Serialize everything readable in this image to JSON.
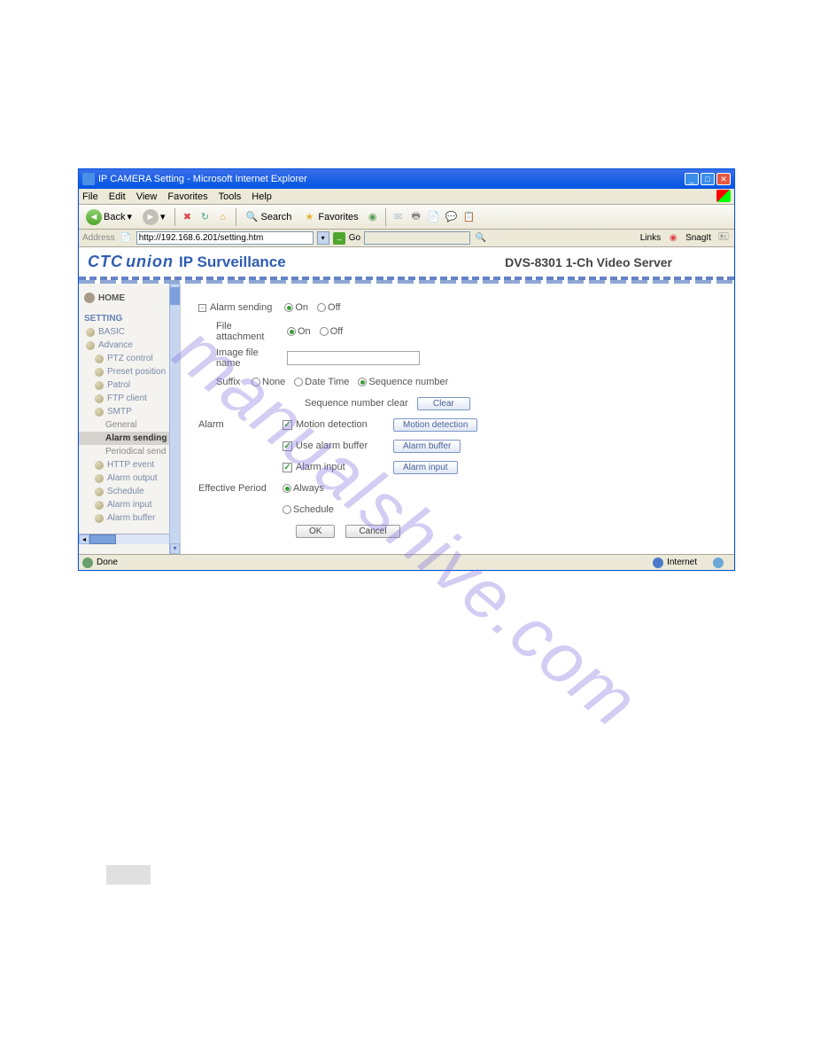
{
  "window": {
    "title": "IP CAMERA Setting - Microsoft Internet Explorer"
  },
  "menubar": [
    "File",
    "Edit",
    "View",
    "Favorites",
    "Tools",
    "Help"
  ],
  "toolbar": {
    "back": "Back",
    "search": "Search",
    "favorites": "Favorites"
  },
  "addressbar": {
    "label": "Address",
    "url": "http://192.168.6.201/setting.htm",
    "go": "Go",
    "links": "Links",
    "snagit": "SnagIt"
  },
  "header": {
    "logo_top": "CTC",
    "logo_bottom": "union",
    "title": "IP Surveillance",
    "product": "DVS-8301 1-Ch Video Server"
  },
  "sidebar": {
    "home": "HOME",
    "section": "SETTING",
    "items": [
      {
        "label": "BASIC",
        "level": 1
      },
      {
        "label": "Advance",
        "level": 1
      },
      {
        "label": "PTZ control",
        "level": 2
      },
      {
        "label": "Preset position",
        "level": 2
      },
      {
        "label": "Patrol",
        "level": 2
      },
      {
        "label": "FTP client",
        "level": 2
      },
      {
        "label": "SMTP",
        "level": 2
      },
      {
        "label": "General",
        "level": 3
      },
      {
        "label": "Alarm sending",
        "level": 3,
        "active": true
      },
      {
        "label": "Periodical send",
        "level": 3
      },
      {
        "label": "HTTP event",
        "level": 2
      },
      {
        "label": "Alarm output",
        "level": 2
      },
      {
        "label": "Schedule",
        "level": 2
      },
      {
        "label": "Alarm input",
        "level": 2
      },
      {
        "label": "Alarm buffer",
        "level": 2
      }
    ]
  },
  "form": {
    "alarm_sending": {
      "label": "Alarm sending",
      "on": "On",
      "off": "Off",
      "selected": "On"
    },
    "file_attachment": {
      "label": "File attachment",
      "on": "On",
      "off": "Off",
      "selected": "On"
    },
    "image_file_name": {
      "label": "Image file name",
      "value": ""
    },
    "suffix": {
      "label": "Suffix",
      "none": "None",
      "datetime": "Date Time",
      "seqnum": "Sequence number",
      "selected": "Sequence number"
    },
    "seq_clear": {
      "label": "Sequence number clear",
      "btn": "Clear"
    },
    "alarm": {
      "label": "Alarm",
      "motion": {
        "label": "Motion detection",
        "btn": "Motion detection",
        "checked": true
      },
      "buffer": {
        "label": "Use alarm buffer",
        "btn": "Alarm buffer",
        "checked": true
      },
      "input": {
        "label": "Alarm input",
        "btn": "Alarm input",
        "checked": true
      }
    },
    "effective": {
      "label": "Effective Period",
      "always": "Always",
      "schedule": "Schedule",
      "selected": "Always"
    },
    "ok": "OK",
    "cancel": "Cancel"
  },
  "statusbar": {
    "done": "Done",
    "internet": "Internet"
  },
  "watermark": "manualshive.com"
}
